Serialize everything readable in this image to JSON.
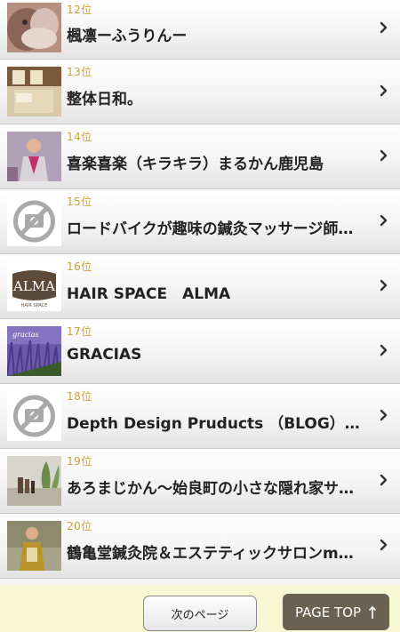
{
  "list": {
    "items": [
      {
        "rank": "12位",
        "title": "楓凛ーふうりんー",
        "thumb": "dog-photo"
      },
      {
        "rank": "13位",
        "title": "整体日和。",
        "thumb": "room-photo"
      },
      {
        "rank": "14位",
        "title": "喜楽喜楽（キラキラ）まるかん鹿児島",
        "thumb": "person-photo"
      },
      {
        "rank": "15位",
        "title": "ロードバイクが趣味の鍼灸マッサージ師の日々",
        "thumb": "no-image"
      },
      {
        "rank": "16位",
        "title": "HAIR SPACE　ALMA",
        "thumb": "alma-logo",
        "logo_text": "ALMA",
        "logo_subtext": "HAIR SPACE"
      },
      {
        "rank": "17位",
        "title": "GRACIAS",
        "thumb": "lavender-photo",
        "logo_text": "gracias"
      },
      {
        "rank": "18位",
        "title": "Depth Design Pruducts （BLOG）［Depth Design]",
        "thumb": "no-image"
      },
      {
        "rank": "19位",
        "title": "あろまじかん〜始良町の小さな隠れ家サロン〜",
        "thumb": "bottles-photo"
      },
      {
        "rank": "20位",
        "title": "鶴亀堂鍼灸院＆エステティックサロンmブログ",
        "thumb": "person-photo"
      }
    ]
  },
  "footer": {
    "next_label": "次のページ",
    "pagetop_label": "PAGE TOP"
  },
  "colors": {
    "rank": "#c8a23a",
    "footer_bg": "#f8f7d4",
    "pagetop_bg": "#6b6152"
  },
  "icons": {
    "chevron": "chevron-right-icon",
    "arrow_up": "arrow-up-icon",
    "no_image": "no-image-icon"
  }
}
